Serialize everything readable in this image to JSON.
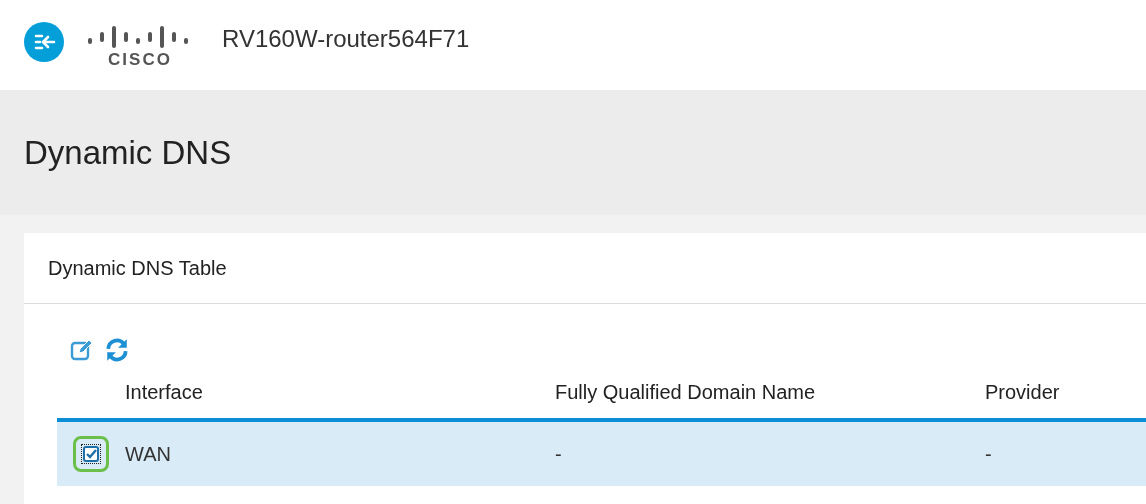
{
  "header": {
    "logo_text": "CISCO",
    "device_name": "RV160W-router564F71"
  },
  "page_title": "Dynamic DNS",
  "card": {
    "title": "Dynamic DNS Table",
    "columns": [
      "Interface",
      "Fully Qualified Domain Name",
      "Provider"
    ],
    "rows": [
      {
        "selected": true,
        "checked": true,
        "highlighted": true,
        "cells": [
          "WAN",
          "-",
          "-"
        ]
      }
    ]
  }
}
